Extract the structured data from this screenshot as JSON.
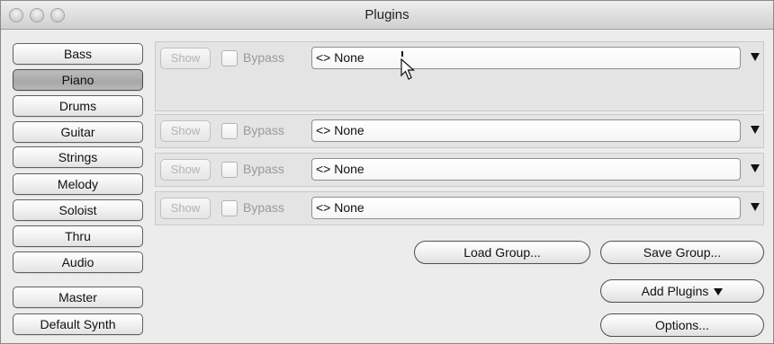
{
  "window": {
    "title": "Plugins"
  },
  "categories": [
    {
      "label": "Bass",
      "selected": false
    },
    {
      "label": "Piano",
      "selected": true
    },
    {
      "label": "Drums",
      "selected": false
    },
    {
      "label": "Guitar",
      "selected": false
    },
    {
      "label": "Strings",
      "selected": false
    },
    {
      "label": "Melody",
      "selected": false
    },
    {
      "label": "Soloist",
      "selected": false
    },
    {
      "label": "Thru",
      "selected": false
    },
    {
      "label": "Audio",
      "selected": false
    },
    {
      "label": "Master",
      "selected": false
    },
    {
      "label": "Default Synth",
      "selected": false
    }
  ],
  "slots": [
    {
      "show_label": "Show",
      "bypass_label": "Bypass",
      "bypass_checked": false,
      "plugin_value": "<> None"
    },
    {
      "show_label": "Show",
      "bypass_label": "Bypass",
      "bypass_checked": false,
      "plugin_value": "<> None"
    },
    {
      "show_label": "Show",
      "bypass_label": "Bypass",
      "bypass_checked": false,
      "plugin_value": "<> None"
    },
    {
      "show_label": "Show",
      "bypass_label": "Bypass",
      "bypass_checked": false,
      "plugin_value": "<> None"
    }
  ],
  "actions": {
    "load_group": "Load Group...",
    "save_group": "Save Group...",
    "add_plugins": "Add Plugins",
    "options": "Options..."
  },
  "icons": {
    "dropdown": "triangle-down-icon",
    "cursor": "mouse-pointer-icon"
  }
}
